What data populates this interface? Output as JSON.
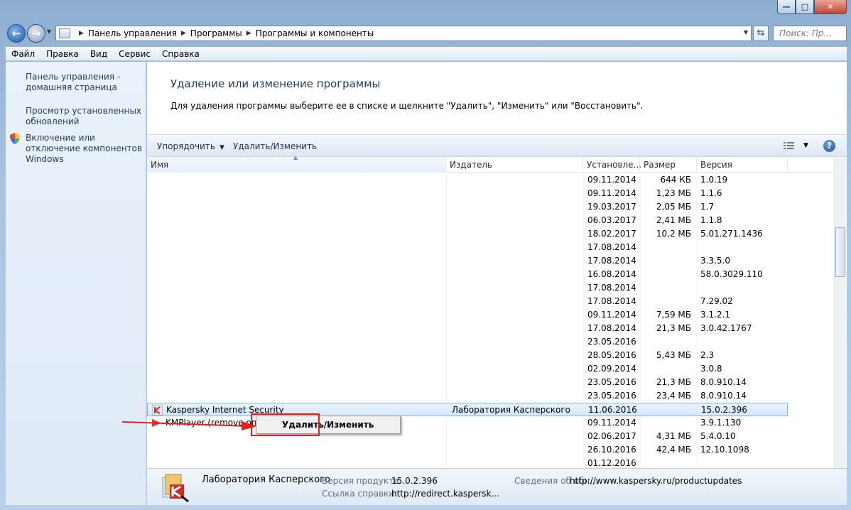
{
  "window": {
    "buttons": {
      "minimize": "—",
      "maximize": "□",
      "close": "✕"
    }
  },
  "address_bar": {
    "crumbs": [
      "Панель управления",
      "Программы",
      "Программы и компоненты"
    ],
    "search_placeholder": "Поиск: Пр..."
  },
  "menu": [
    "Файл",
    "Правка",
    "Вид",
    "Сервис",
    "Справка"
  ],
  "sidebar": {
    "items": [
      {
        "label": "Панель управления - домашняя страница"
      },
      {
        "label": "Просмотр установленных обновлений"
      },
      {
        "label": "Включение или отключение компонентов Windows",
        "icon": "shield-icon"
      }
    ]
  },
  "main": {
    "title": "Удаление или изменение программы",
    "subtitle": "Для удаления программы выберите ее в списке и щелкните \"Удалить\", \"Изменить\" или \"Восстановить\".",
    "toolbar": {
      "organize": "Упорядочить",
      "uninstall": "Удалить/Изменить"
    },
    "columns": [
      "Имя",
      "Издатель",
      "Установле...",
      "Размер",
      "Версия"
    ]
  },
  "programs": [
    {
      "name": "",
      "publisher": "",
      "date": "09.11.2014",
      "size": "644 КБ",
      "version": "1.0.19"
    },
    {
      "name": "",
      "publisher": "",
      "date": "09.11.2014",
      "size": "1,23 МБ",
      "version": "1.1.6"
    },
    {
      "name": "",
      "publisher": "",
      "date": "19.03.2017",
      "size": "2,05 МБ",
      "version": "1.7"
    },
    {
      "name": "",
      "publisher": "",
      "date": "06.03.2017",
      "size": "2,41 МБ",
      "version": "1.1.8"
    },
    {
      "name": "",
      "publisher": "",
      "date": "18.02.2017",
      "size": "10,2 МБ",
      "version": "5.01.271.1436"
    },
    {
      "name": "",
      "publisher": "",
      "date": "17.08.2014",
      "size": "",
      "version": ""
    },
    {
      "name": "",
      "publisher": "",
      "date": "17.08.2014",
      "size": "",
      "version": "3.3.5.0"
    },
    {
      "name": "",
      "publisher": "",
      "date": "16.08.2014",
      "size": "",
      "version": "58.0.3029.110"
    },
    {
      "name": "",
      "publisher": "",
      "date": "17.08.2014",
      "size": "",
      "version": ""
    },
    {
      "name": "",
      "publisher": "",
      "date": "17.08.2014",
      "size": "",
      "version": "7.29.02"
    },
    {
      "name": "",
      "publisher": "",
      "date": "09.11.2014",
      "size": "7,59 МБ",
      "version": "3.1.2.1"
    },
    {
      "name": "",
      "publisher": "",
      "date": "17.08.2014",
      "size": "21,3 МБ",
      "version": "3.0.42.1767"
    },
    {
      "name": "",
      "publisher": "",
      "date": "23.05.2016",
      "size": "",
      "version": ""
    },
    {
      "name": "",
      "publisher": "",
      "date": "28.05.2016",
      "size": "5,43 МБ",
      "version": "2.3"
    },
    {
      "name": "",
      "publisher": "",
      "date": "02.09.2014",
      "size": "",
      "version": "3.0.8"
    },
    {
      "name": "",
      "publisher": "",
      "date": "23.05.2016",
      "size": "21,3 МБ",
      "version": "8.0.910.14"
    },
    {
      "name": "",
      "publisher": "",
      "date": "23.05.2016",
      "size": "23,4 МБ",
      "version": "8.0.910.14"
    },
    {
      "name": "Kaspersky Internet Security",
      "publisher": "Лаборатория Касперского",
      "date": "11.06.2016",
      "size": "",
      "version": "15.0.2.396",
      "selected": true,
      "icon": "kaspersky-icon"
    },
    {
      "name": "KMPlayer (remove only)",
      "publisher": "",
      "date": "09.11.2014",
      "size": "",
      "version": "3.9.1.130",
      "icon": "kmplayer-icon"
    },
    {
      "name": "",
      "publisher": "",
      "date": "02.06.2017",
      "size": "4,31 МБ",
      "version": "5.4.0.10"
    },
    {
      "name": "",
      "publisher": "",
      "date": "26.10.2016",
      "size": "42,4 МБ",
      "version": "12.10.1098"
    },
    {
      "name": "",
      "publisher": "",
      "date": "01.12.2016",
      "size": "",
      "version": ""
    }
  ],
  "context_menu": {
    "item": "Удалить/Изменить"
  },
  "details": {
    "publisher": "Лаборатория Касперского",
    "version_label": "Версия продукта:",
    "version": "15.0.2.396",
    "support_label": "Ссылка справки:",
    "support_link": "http://redirect.kaspersk...",
    "info_label": "Сведения об обн...",
    "info_link": "http://www.kaspersky.ru/productupdates"
  },
  "colors": {
    "accent": "#1e395b",
    "highlight": "#e0201f",
    "selection": "#d6e7fb"
  }
}
